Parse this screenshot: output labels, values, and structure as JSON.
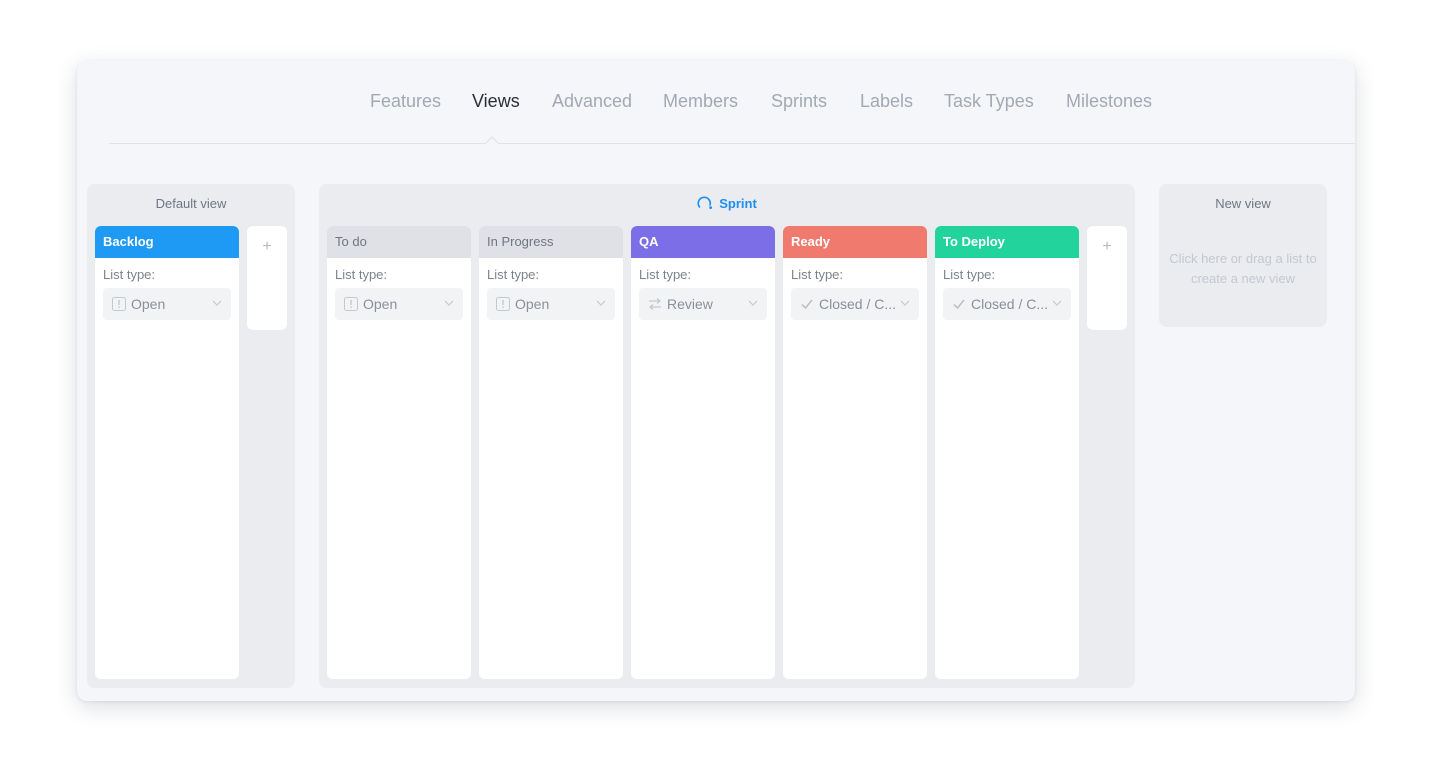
{
  "tabs": [
    {
      "label": "Features",
      "active": false
    },
    {
      "label": "Views",
      "active": true
    },
    {
      "label": "Advanced",
      "active": false
    },
    {
      "label": "Members",
      "active": false
    },
    {
      "label": "Sprints",
      "active": false
    },
    {
      "label": "Labels",
      "active": false
    },
    {
      "label": "Task Types",
      "active": false
    },
    {
      "label": "Milestones",
      "active": false
    }
  ],
  "default_view": {
    "title": "Default view",
    "lists": [
      {
        "name": "Backlog",
        "color": "#1e9af5",
        "type_label": "List type:",
        "type": "Open",
        "type_icon": "exclamation-icon"
      }
    ],
    "add_symbol": "+"
  },
  "sprint_view": {
    "title": "Sprint",
    "title_icon": "sprint-icon",
    "lists": [
      {
        "name": "To do",
        "color": "#dfe1e6",
        "type_label": "List type:",
        "type": "Open",
        "type_icon": "exclamation-icon"
      },
      {
        "name": "In Progress",
        "color": "#dfe1e6",
        "type_label": "List type:",
        "type": "Open",
        "type_icon": "exclamation-icon"
      },
      {
        "name": "QA",
        "color": "#7b6ee6",
        "type_label": "List type:",
        "type": "Review",
        "type_icon": "swap-arrows-icon"
      },
      {
        "name": "Ready",
        "color": "#f07a6e",
        "type_label": "List type:",
        "type": "Closed / C...",
        "type_icon": "check-icon"
      },
      {
        "name": "To Deploy",
        "color": "#22d39c",
        "type_label": "List type:",
        "type": "Closed / C...",
        "type_icon": "check-icon"
      }
    ],
    "add_symbol": "+"
  },
  "new_view": {
    "title": "New view",
    "hint": "Click here or drag a list to create a new view"
  },
  "colors": {
    "accent": "#1e8ef0",
    "backlog": "#1e9af5",
    "qa": "#7b6ee6",
    "ready": "#f07a6e",
    "to_deploy": "#22d39c"
  }
}
